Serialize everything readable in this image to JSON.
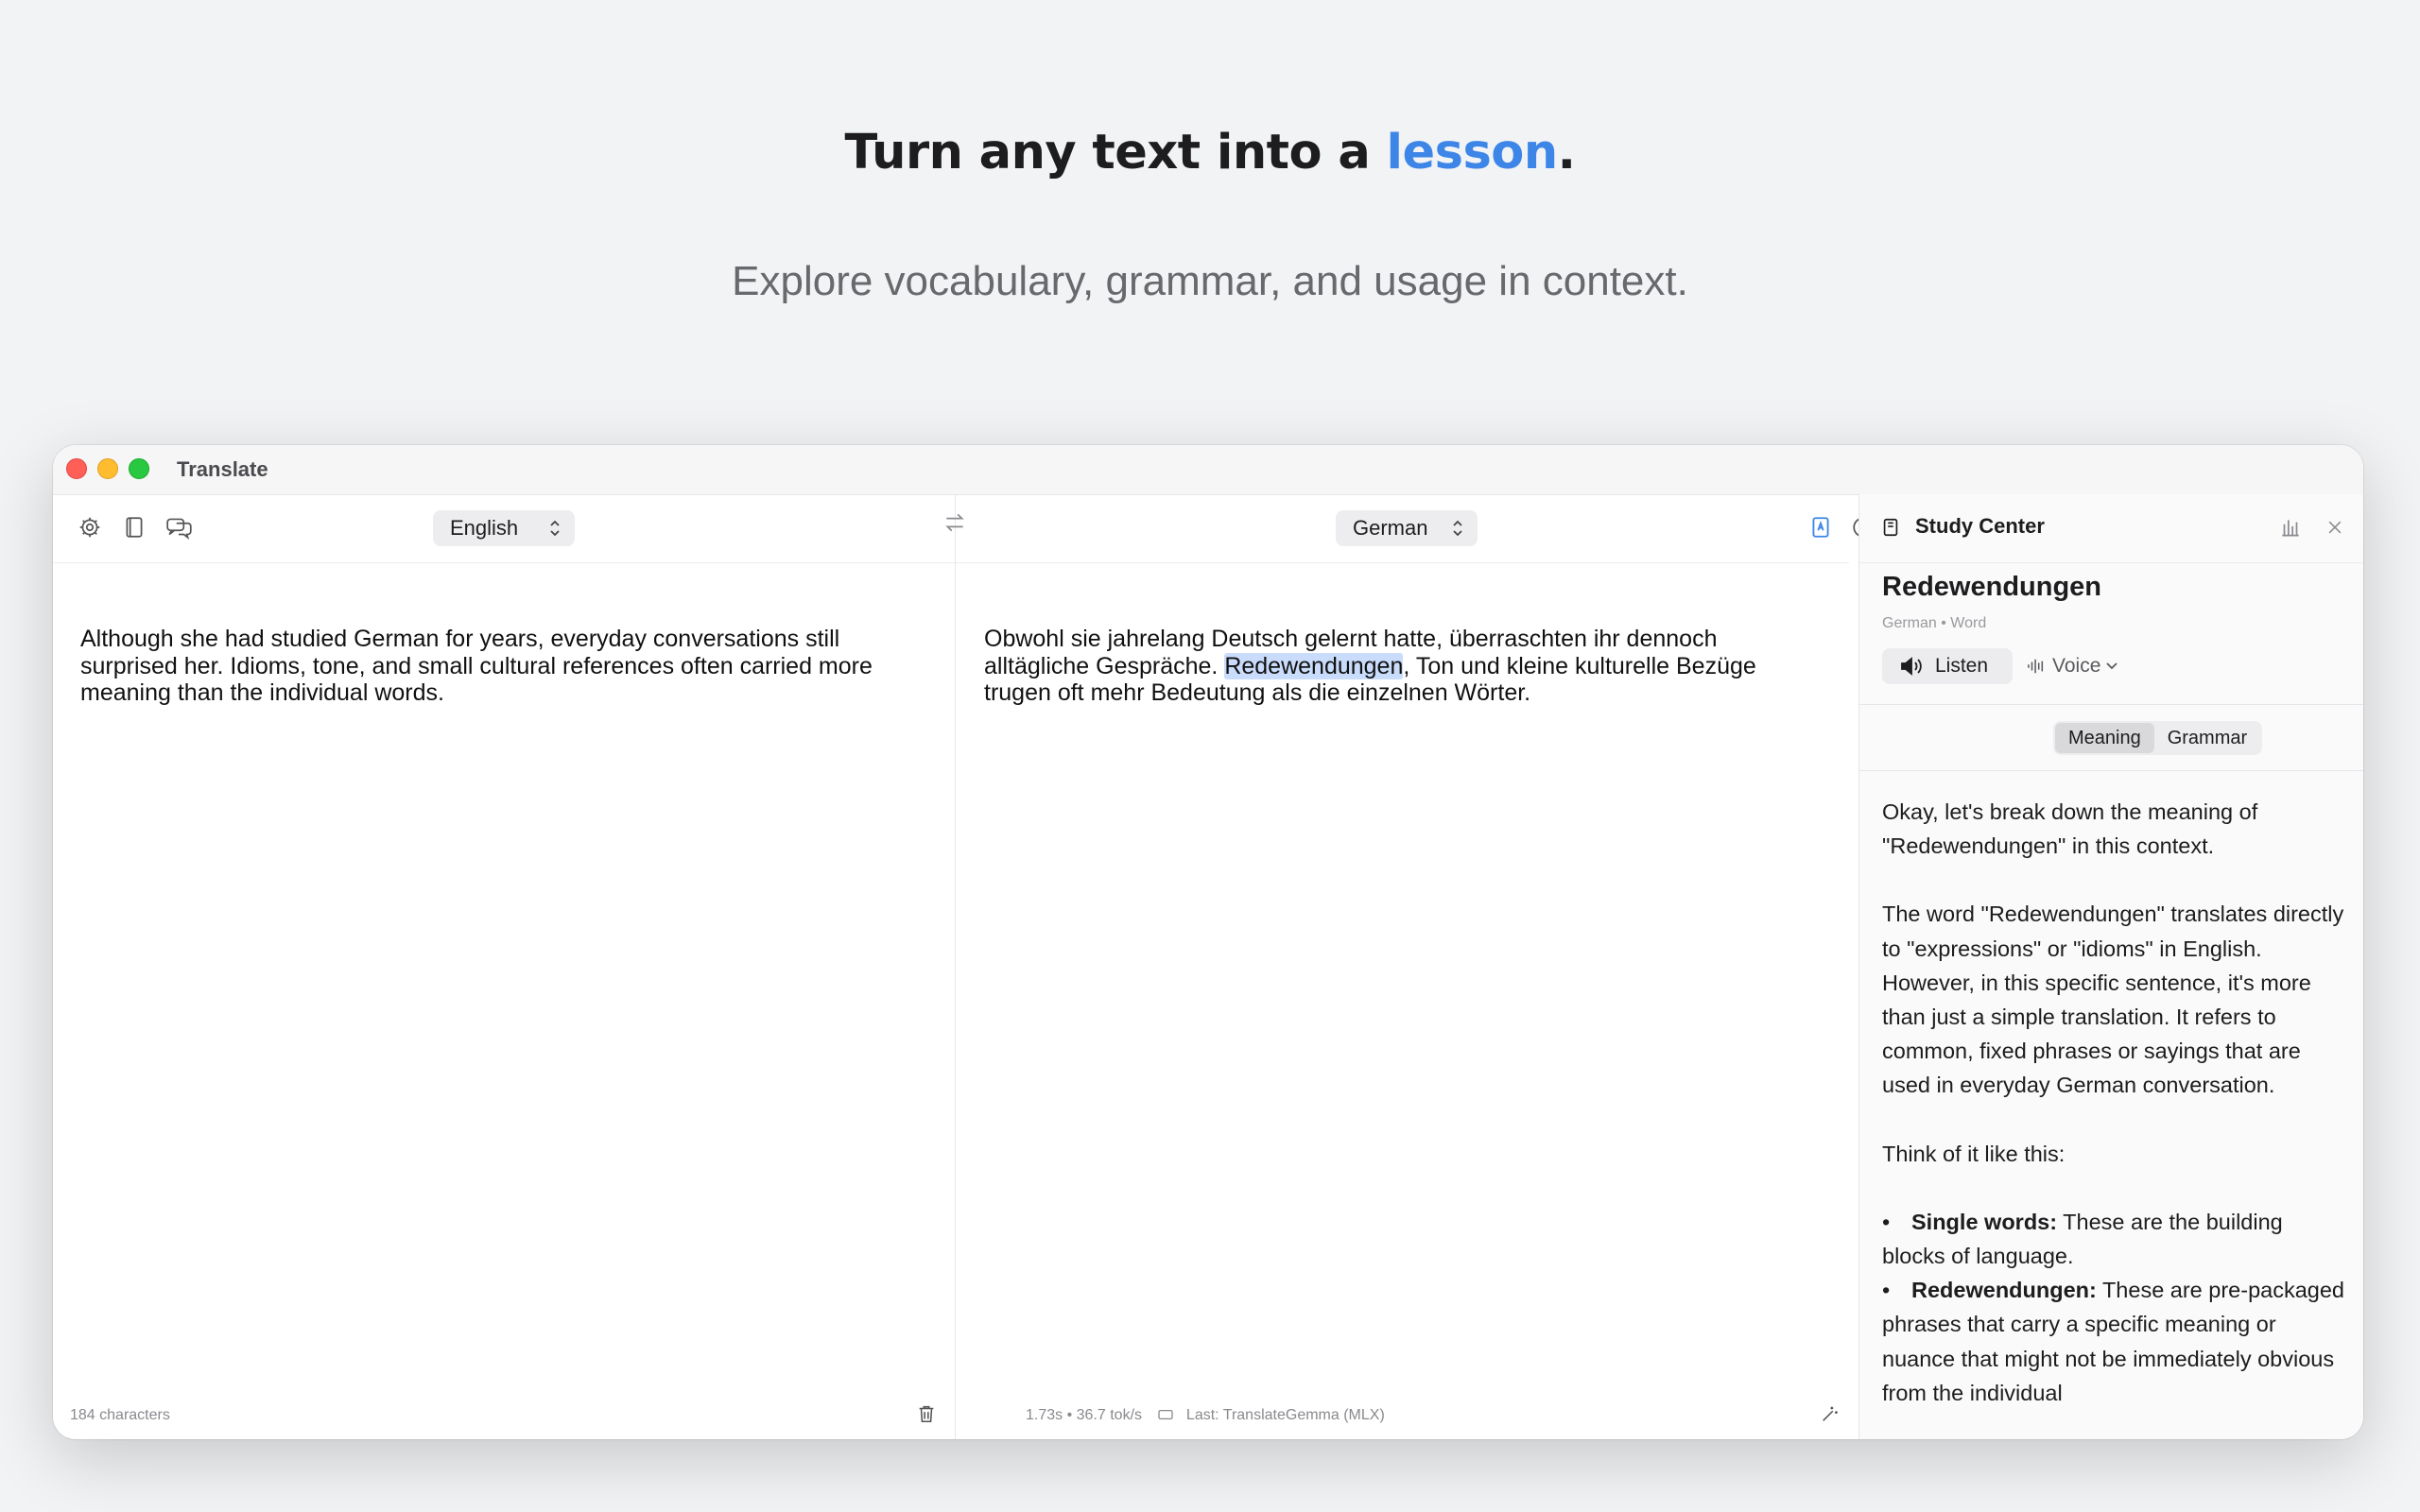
{
  "hero": {
    "title_prefix": "Turn any text into a ",
    "title_accent": "lesson",
    "title_suffix": ".",
    "subtitle": "Explore vocabulary, grammar, and usage in context."
  },
  "window": {
    "title": "Translate"
  },
  "source": {
    "language": "English",
    "text": "Although she had studied German for years, everyday conversations still surprised her. Idioms, tone, and small cultural references often carried more meaning than the individual words.",
    "char_count": "184 characters"
  },
  "target": {
    "language": "German",
    "text_before": "Obwohl sie jahrelang Deutsch gelernt hatte, überraschten ihr dennoch alltägliche Gespräche. ",
    "text_highlight": "Redewendungen",
    "text_after": ", Ton und kleine kulturelle Bezüge trugen oft mehr Bedeutung als die einzelnen Wörter.",
    "stats": "1.73s • 36.7 tok/s",
    "last_model": "Last: TranslateGemma (MLX)"
  },
  "study": {
    "title": "Study Center",
    "word": "Redewendungen",
    "meta": "German • Word",
    "listen_label": "Listen",
    "voice_label": "Voice",
    "tabs": [
      {
        "label": "Meaning",
        "active": true
      },
      {
        "label": "Grammar",
        "active": false
      }
    ],
    "paragraphs": [
      "Okay, let's break down the meaning of \"Redewendungen\" in this context.",
      "The word \"Redewendungen\" translates directly to \"expressions\" or \"idioms\" in English. However, in this specific sentence, it's more than just a simple translation. It refers to common, fixed phrases or sayings that are used in everyday German conversation.",
      "Think of it like this:"
    ],
    "bullets": [
      {
        "term": "Single words:",
        "text": " These are the building blocks of language."
      },
      {
        "term": "Redewendungen:",
        "text": " These are pre-packaged phrases that carry a specific meaning or nuance that might not be immediately obvious from the individual"
      }
    ]
  },
  "icons": {
    "toolbar_left": [
      "gear-icon",
      "book-icon",
      "chat-bubbles-icon"
    ],
    "swap": "swap-arrows-icon",
    "toolbar_right": [
      "study-mode-icon",
      "help-icon"
    ],
    "study_right": [
      "chart-icon",
      "close-icon"
    ],
    "footer": [
      "trash-icon",
      "display-icon",
      "magic-wand-icon",
      "copy-icon"
    ]
  },
  "colors": {
    "accent": "#3d86e8",
    "highlight": "#c9dcfb"
  }
}
